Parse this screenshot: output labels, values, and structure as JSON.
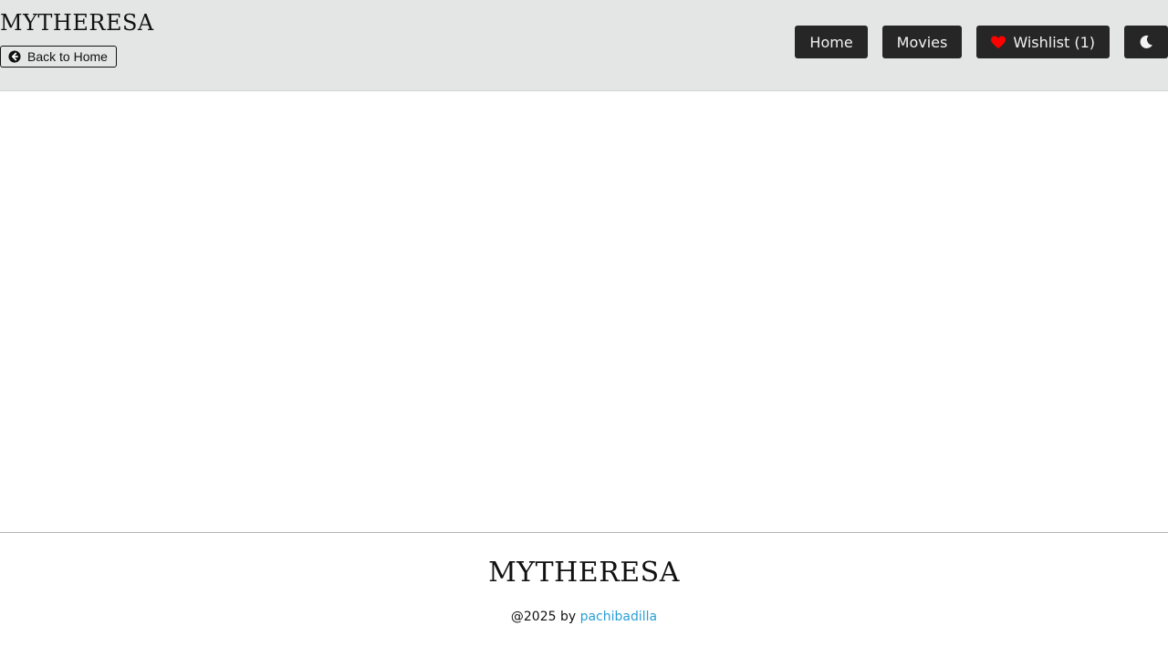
{
  "header": {
    "brand": "MYTHERESA",
    "back_label": "Back to Home",
    "nav": {
      "home": "Home",
      "movies": "Movies",
      "wishlist": "Wishlist (1)"
    },
    "icons": {
      "back": "arrow-circle-left-icon",
      "wishlist": "heart-icon",
      "theme": "moon-icon"
    }
  },
  "colors": {
    "header_bg": "#e4e6e5",
    "button_bg": "#262626",
    "heart": "#ff0000",
    "link": "#2a9fd6"
  },
  "footer": {
    "brand": "MYTHERESA",
    "copyright_prefix": "@2025 by",
    "author": "pachibadilla"
  }
}
